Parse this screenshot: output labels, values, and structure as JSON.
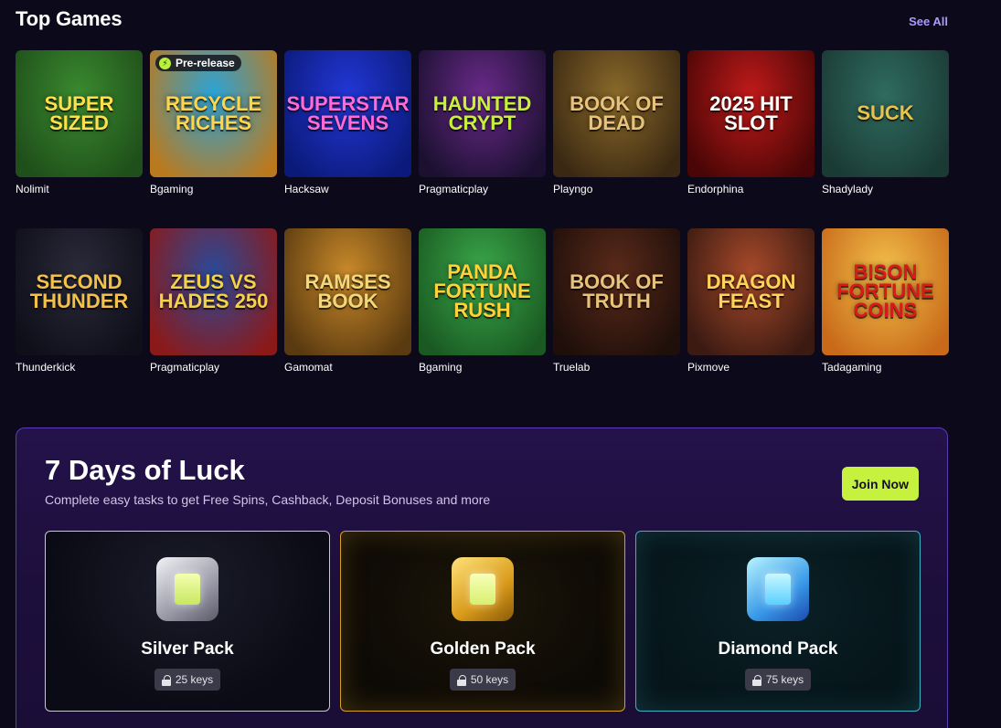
{
  "header": {
    "title": "Top Games",
    "see_all": "See All"
  },
  "games": [
    {
      "art": "SUPER SIZED",
      "provider": "Nolimit",
      "colors": [
        "#3a8a2f",
        "#1f4f1a"
      ],
      "text": "#ffe04a",
      "badge": ""
    },
    {
      "art": "RECYCLE RICHES",
      "provider": "Bgaming",
      "colors": [
        "#2aa4d9",
        "#b97a1f"
      ],
      "text": "#ffd54a",
      "badge": "Pre-release"
    },
    {
      "art": "SUPERSTAR SEVENS",
      "provider": "Hacksaw",
      "colors": [
        "#2237d6",
        "#0b1a7a"
      ],
      "text": "#ff6ad5",
      "badge": ""
    },
    {
      "art": "HAUNTED CRYPT",
      "provider": "Pragmaticplay",
      "colors": [
        "#6a2a8a",
        "#1b1030"
      ],
      "text": "#c7f03a",
      "badge": ""
    },
    {
      "art": "BOOK OF DEAD",
      "provider": "Playngo",
      "colors": [
        "#8a6a2a",
        "#3a2812"
      ],
      "text": "#e8c27a",
      "badge": ""
    },
    {
      "art": "2025 HIT SLOT",
      "provider": "Endorphina",
      "colors": [
        "#c11a1a",
        "#4a0606"
      ],
      "text": "#ffffff",
      "badge": ""
    },
    {
      "art": "SUCK",
      "provider": "Shadylady",
      "colors": [
        "#2f6b5f",
        "#1a3a34"
      ],
      "text": "#e8c24a",
      "badge": ""
    },
    {
      "art": "SECOND THUNDER",
      "provider": "Thunderkick",
      "colors": [
        "#2a2a3a",
        "#0f0f1a"
      ],
      "text": "#f3c04a",
      "badge": ""
    },
    {
      "art": "ZEUS VS HADES 250",
      "provider": "Pragmaticplay",
      "colors": [
        "#2a4a9a",
        "#8a1a1a"
      ],
      "text": "#f3d24a",
      "badge": ""
    },
    {
      "art": "RAMSES BOOK",
      "provider": "Gamomat",
      "colors": [
        "#c98a2a",
        "#5a3a10"
      ],
      "text": "#f3d87a",
      "badge": ""
    },
    {
      "art": "PANDA FORTUNE RUSH",
      "provider": "Bgaming",
      "colors": [
        "#3aa84a",
        "#1a5a22"
      ],
      "text": "#ffd23a",
      "badge": ""
    },
    {
      "art": "BOOK OF TRUTH",
      "provider": "Truelab",
      "colors": [
        "#5a2a1a",
        "#1f0f0a"
      ],
      "text": "#e8c27a",
      "badge": ""
    },
    {
      "art": "DRAGON FEAST",
      "provider": "Pixmove",
      "colors": [
        "#a84a2a",
        "#3a1a12"
      ],
      "text": "#ffd25a",
      "badge": ""
    },
    {
      "art": "BISON FORTUNE COINS",
      "provider": "Tadagaming",
      "colors": [
        "#f3c04a",
        "#c86a1a"
      ],
      "text": "#d81a1a",
      "badge": ""
    }
  ],
  "promo": {
    "title": "7 Days of Luck",
    "subtitle": "Complete easy tasks to get Free Spins, Cashback, Deposit Bonuses and more",
    "join_label": "Join Now",
    "packs": [
      {
        "name": "Silver Pack",
        "keys": "25 keys",
        "kind": "silver"
      },
      {
        "name": "Golden Pack",
        "keys": "50 keys",
        "kind": "gold"
      },
      {
        "name": "Diamond Pack",
        "keys": "75 keys",
        "kind": "diamond"
      }
    ]
  }
}
